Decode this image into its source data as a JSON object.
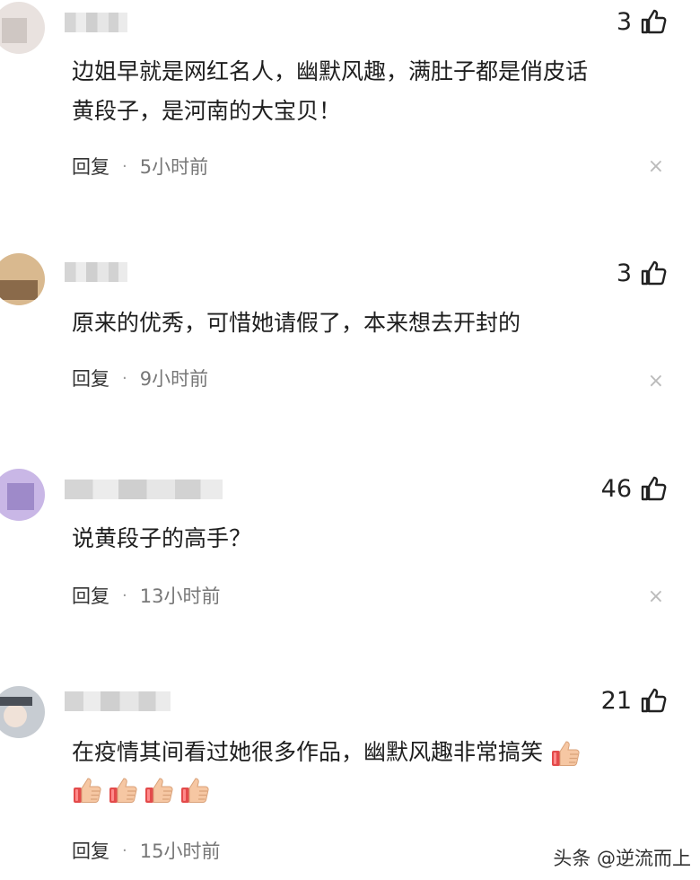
{
  "comments": [
    {
      "likes": "3",
      "lines": [
        "边姐早就是网红名人，幽默风趣，满肚子都是俏皮话",
        "黄段子，是河南的大宝贝！"
      ],
      "reply_label": "回复",
      "separator": "·",
      "time": "5小时前"
    },
    {
      "likes": "3",
      "lines": [
        "原来的优秀，可惜她请假了，本来想去开封的"
      ],
      "reply_label": "回复",
      "separator": "·",
      "time": "9小时前"
    },
    {
      "likes": "46",
      "lines": [
        "说黄段子的高手？"
      ],
      "reply_label": "回复",
      "separator": "·",
      "time": "13小时前"
    },
    {
      "likes": "21",
      "lines": [
        "在疫情其间看过她很多作品，幽默风趣非常搞笑"
      ],
      "emoji": "thumbs-up",
      "reply_label": "回复",
      "separator": "·",
      "time": "15小时前"
    }
  ],
  "close_glyph": "×",
  "watermark": "头条 @逆流而上",
  "icons": {
    "like": "thumbs-up-outline-icon",
    "close": "close-icon",
    "emoji": "thumbs-up-emoji-icon"
  },
  "colors": {
    "emoji_fill": "#f6c7a3",
    "emoji_cuff": "#e34b4b"
  }
}
